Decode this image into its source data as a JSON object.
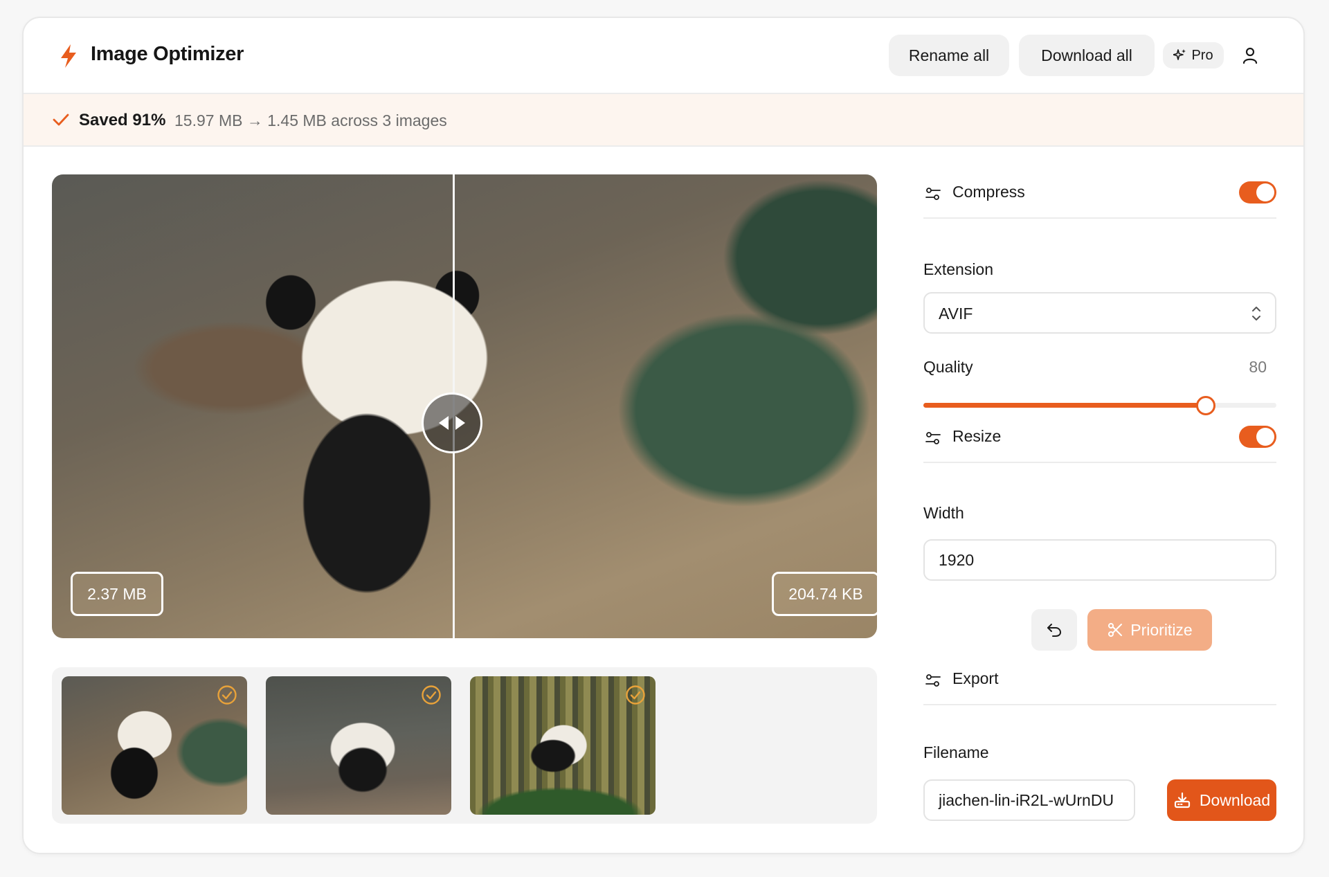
{
  "app": {
    "title": "Image Optimizer"
  },
  "header": {
    "rename_all": "Rename all",
    "download_all": "Download all",
    "pro": "Pro"
  },
  "banner": {
    "saved": "Saved 91%",
    "detail": "15.97 MB → 1.45 MB across 3 images"
  },
  "preview": {
    "size_before": "2.37 MB",
    "size_after": "204.74 KB"
  },
  "thumbnails": [
    {
      "status": "optimized"
    },
    {
      "status": "optimized"
    },
    {
      "status": "optimized"
    }
  ],
  "compress": {
    "title": "Compress",
    "enabled": true,
    "extension_label": "Extension",
    "extension_value": "AVIF",
    "quality_label": "Quality",
    "quality_value": "80",
    "quality_fraction": 0.8
  },
  "resize": {
    "title": "Resize",
    "enabled": true,
    "width_label": "Width",
    "width_value": "1920",
    "prioritize": "Prioritize"
  },
  "export": {
    "title": "Export",
    "filename_label": "Filename",
    "filename_value": "jiachen-lin-iR2L-wUrnDU",
    "download": "Download"
  },
  "colors": {
    "accent": "#e85d1e",
    "banner_bg": "#fdf5ef"
  }
}
